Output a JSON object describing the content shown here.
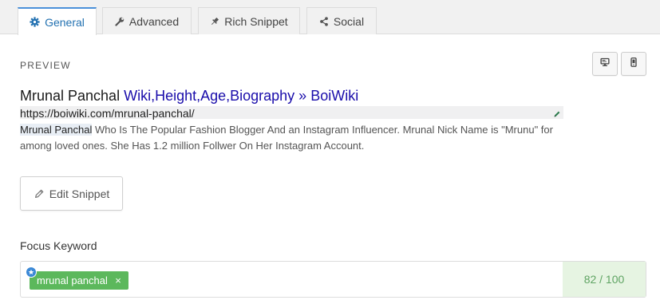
{
  "tabs": [
    {
      "label": "General",
      "icon": "gear-icon",
      "active": true
    },
    {
      "label": "Advanced",
      "icon": "wrench-icon",
      "active": false
    },
    {
      "label": "Rich Snippet",
      "icon": "pin-icon",
      "active": false
    },
    {
      "label": "Social",
      "icon": "share-icon",
      "active": false
    }
  ],
  "preview": {
    "label": "PREVIEW",
    "title_keyword": "Mrunal Panchal",
    "title_rest": " Wiki,Height,Age,Biography » BoiWiki",
    "url": "https://boiwiki.com/mrunal-panchal/",
    "desc_keyword": "Mrunal Panchal",
    "desc_rest": " Who Is The Popular Fashion Blogger And an Instagram Influencer. Mrunal Nick Name is \"Mrunu\" for among loved ones. She Has 1.2 million Follwer On Her Instagram Account."
  },
  "edit_snippet_label": "Edit Snippet",
  "focus": {
    "label": "Focus Keyword",
    "keyword": "mrunal panchal",
    "remove_symbol": "×",
    "score": "82 / 100"
  },
  "colors": {
    "accent": "#4a90d9",
    "title_link": "#1a0dab",
    "tag_green": "#5cb85c",
    "score_bg": "#e6f4e2",
    "score_text": "#5fa463"
  }
}
